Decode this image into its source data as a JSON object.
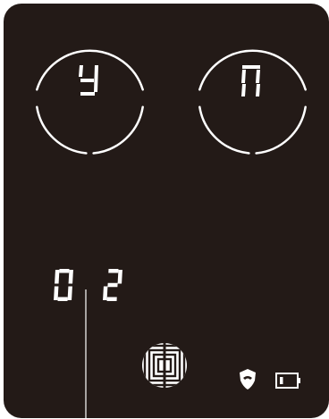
{
  "keys": [
    {
      "glyph": "y"
    },
    {
      "glyph": "n"
    }
  ],
  "display": {
    "digits": [
      "0",
      "2"
    ]
  },
  "status": {
    "icons": [
      "fingerprint-logo-icon",
      "shield-icon",
      "battery-icon"
    ]
  },
  "colors": {
    "panel": "#231a17",
    "segment": "#ffffff"
  }
}
